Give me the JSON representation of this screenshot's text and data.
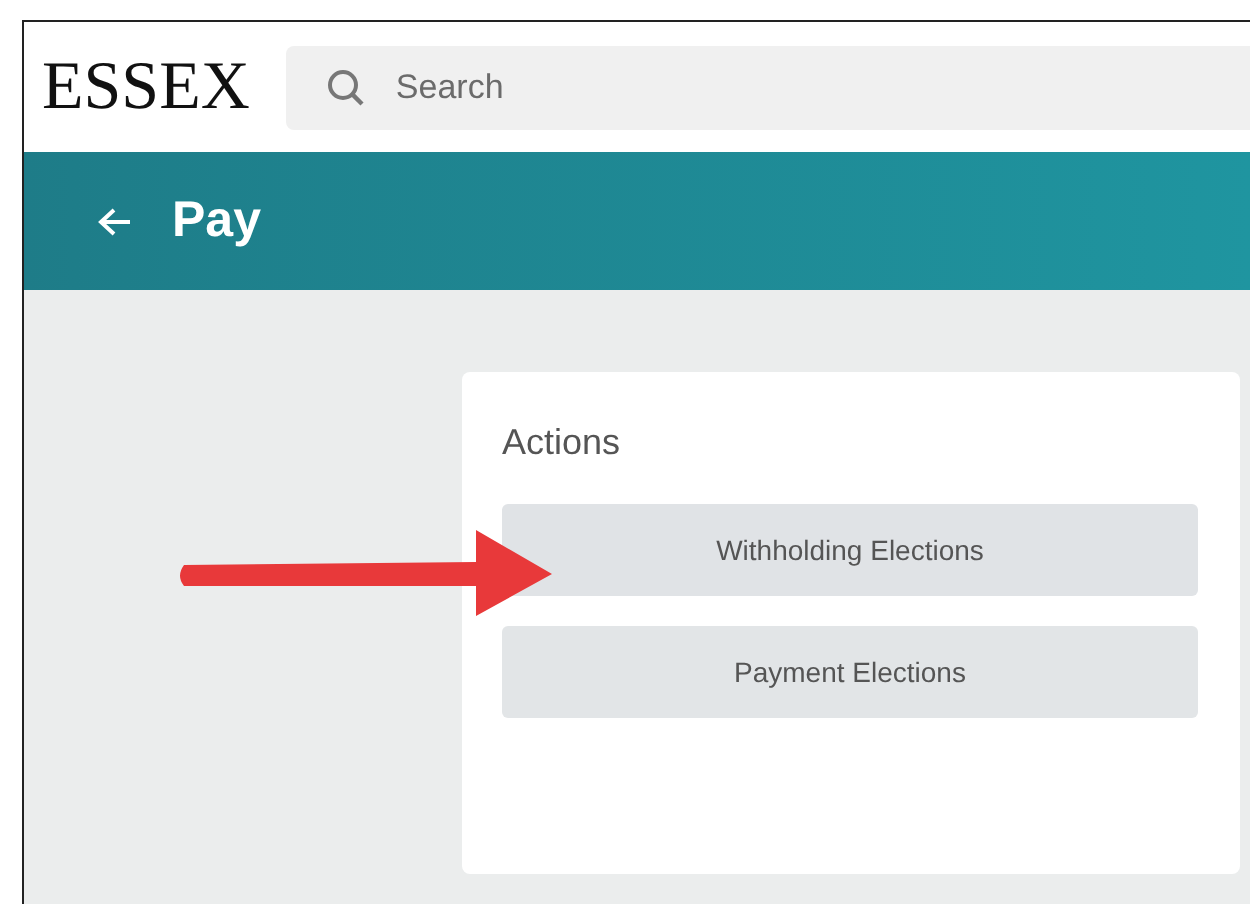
{
  "logo": "ESSEX",
  "search": {
    "placeholder": "Search"
  },
  "header": {
    "title": "Pay"
  },
  "actions": {
    "title": "Actions",
    "buttons": [
      {
        "label": "Withholding Elections",
        "highlighted": true
      },
      {
        "label": "Payment Elections",
        "highlighted": false
      }
    ]
  }
}
